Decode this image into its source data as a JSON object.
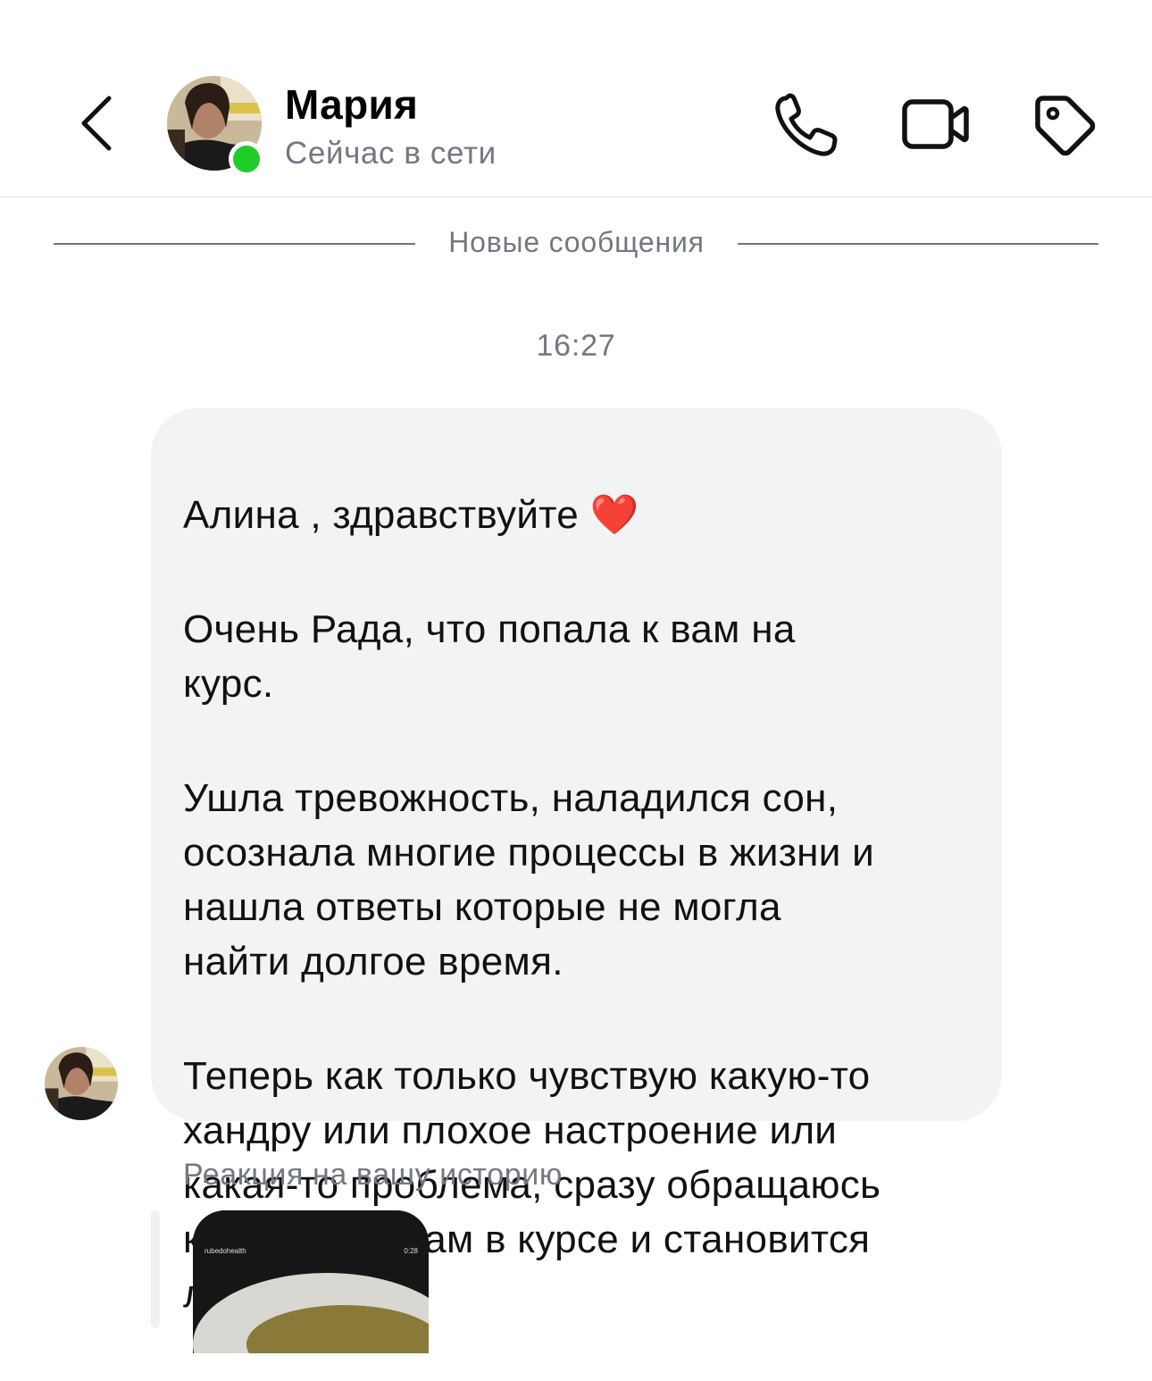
{
  "header": {
    "contact_name": "Мария",
    "status": "Сейчас в сети",
    "colors": {
      "online": "#1fcc2a",
      "secondary_text": "#737880"
    },
    "icons": [
      "back-arrow-icon",
      "phone-icon",
      "video-camera-icon",
      "tag-icon"
    ]
  },
  "separator": {
    "label": "Новые сообщения"
  },
  "chat": {
    "timestamp": "16:27",
    "message": {
      "line1": "Алина , здравствуйте",
      "emoji": "❤️",
      "paragraph1": "Очень Рада, что попала к вам на\nкурс.",
      "paragraph2": "Ушла тревожность, наладился сон,\nосознала многие процессы в жизни и\nнашла ответы которые не могла\nнайти долгое время.",
      "paragraph3": "Теперь как только чувствую какую-то\nхандру или плохое настроение или\nкакая-то проблема, сразу обращаюсь\nк инструментам в курсе и становится\nлегче.",
      "bubble_color": "#f2f3f5"
    },
    "reaction": {
      "label": "Реакция на вашу историю",
      "story_username": "rubedohealth",
      "story_duration": "0:28"
    }
  }
}
